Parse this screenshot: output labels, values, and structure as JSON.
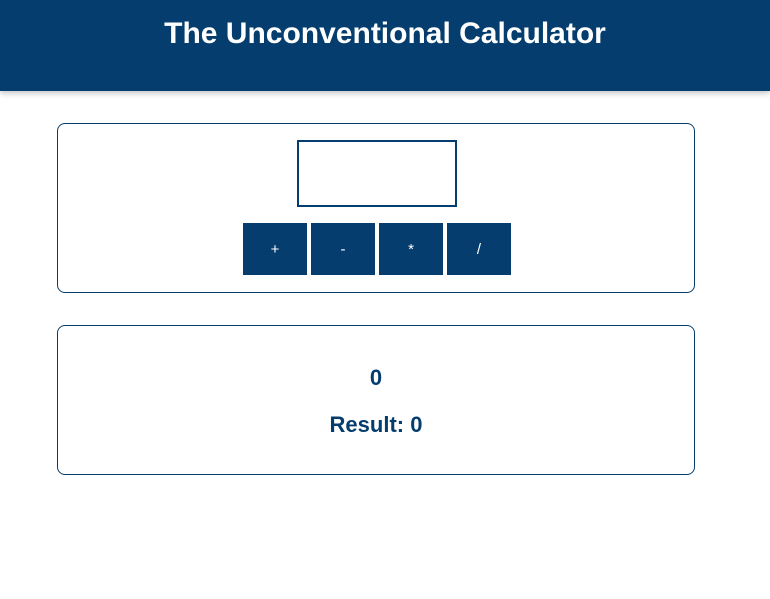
{
  "header": {
    "title": "The Unconventional Calculator"
  },
  "input": {
    "value": "",
    "placeholder": ""
  },
  "operators": [
    {
      "label": "+"
    },
    {
      "label": "-"
    },
    {
      "label": "*"
    },
    {
      "label": "/"
    }
  ],
  "output": {
    "current_value": "0",
    "result_label": "Result:",
    "result_value": "0",
    "result_text": "Result: 0"
  },
  "colors": {
    "brand": "#053e6e",
    "background": "#ffffff",
    "button_text": "#ffffff"
  }
}
